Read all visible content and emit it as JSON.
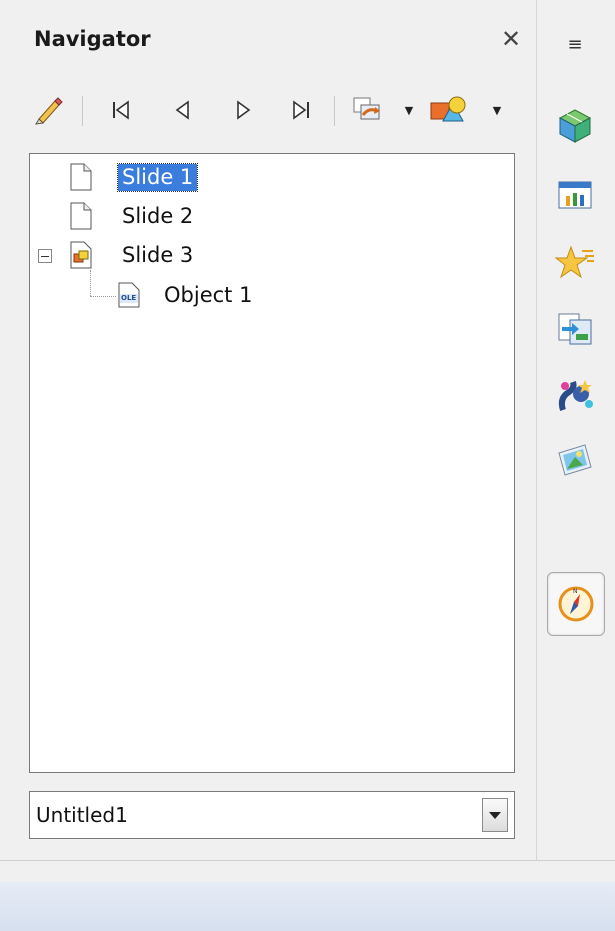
{
  "panel": {
    "title": "Navigator",
    "close_label": "✕"
  },
  "toolbar": {
    "items": [
      {
        "name": "drag-mode-icon"
      },
      {
        "name": "first-slide-button"
      },
      {
        "name": "previous-slide-button"
      },
      {
        "name": "next-slide-button"
      },
      {
        "name": "last-slide-button"
      },
      {
        "name": "drag-options-icon"
      },
      {
        "name": "shapes-filter-icon"
      }
    ]
  },
  "tree": {
    "items": [
      {
        "label": "Slide 1",
        "icon": "page-icon",
        "selected": true
      },
      {
        "label": "Slide 2",
        "icon": "page-icon",
        "selected": false
      },
      {
        "label": "Slide 3",
        "icon": "slide-with-objects-icon",
        "expanded": true,
        "selected": false
      },
      {
        "label": "Object 1",
        "icon": "ole-object-icon",
        "selected": false,
        "child_of": "Slide 3"
      }
    ]
  },
  "ole_badge": "OLE",
  "document_selector": {
    "value": "Untitled1"
  },
  "deck": {
    "menu_icon": "≡",
    "buttons": [
      {
        "name": "properties-icon"
      },
      {
        "name": "master-slides-icon"
      },
      {
        "name": "animation-icon"
      },
      {
        "name": "slide-transition-icon"
      },
      {
        "name": "styles-icon"
      },
      {
        "name": "gallery-icon"
      },
      {
        "name": "navigator-icon",
        "active": true
      }
    ]
  },
  "colors": {
    "selection": "#3b7ddd",
    "panel_bg": "#f0f0f0",
    "statusbar": "#dbe3f0"
  }
}
